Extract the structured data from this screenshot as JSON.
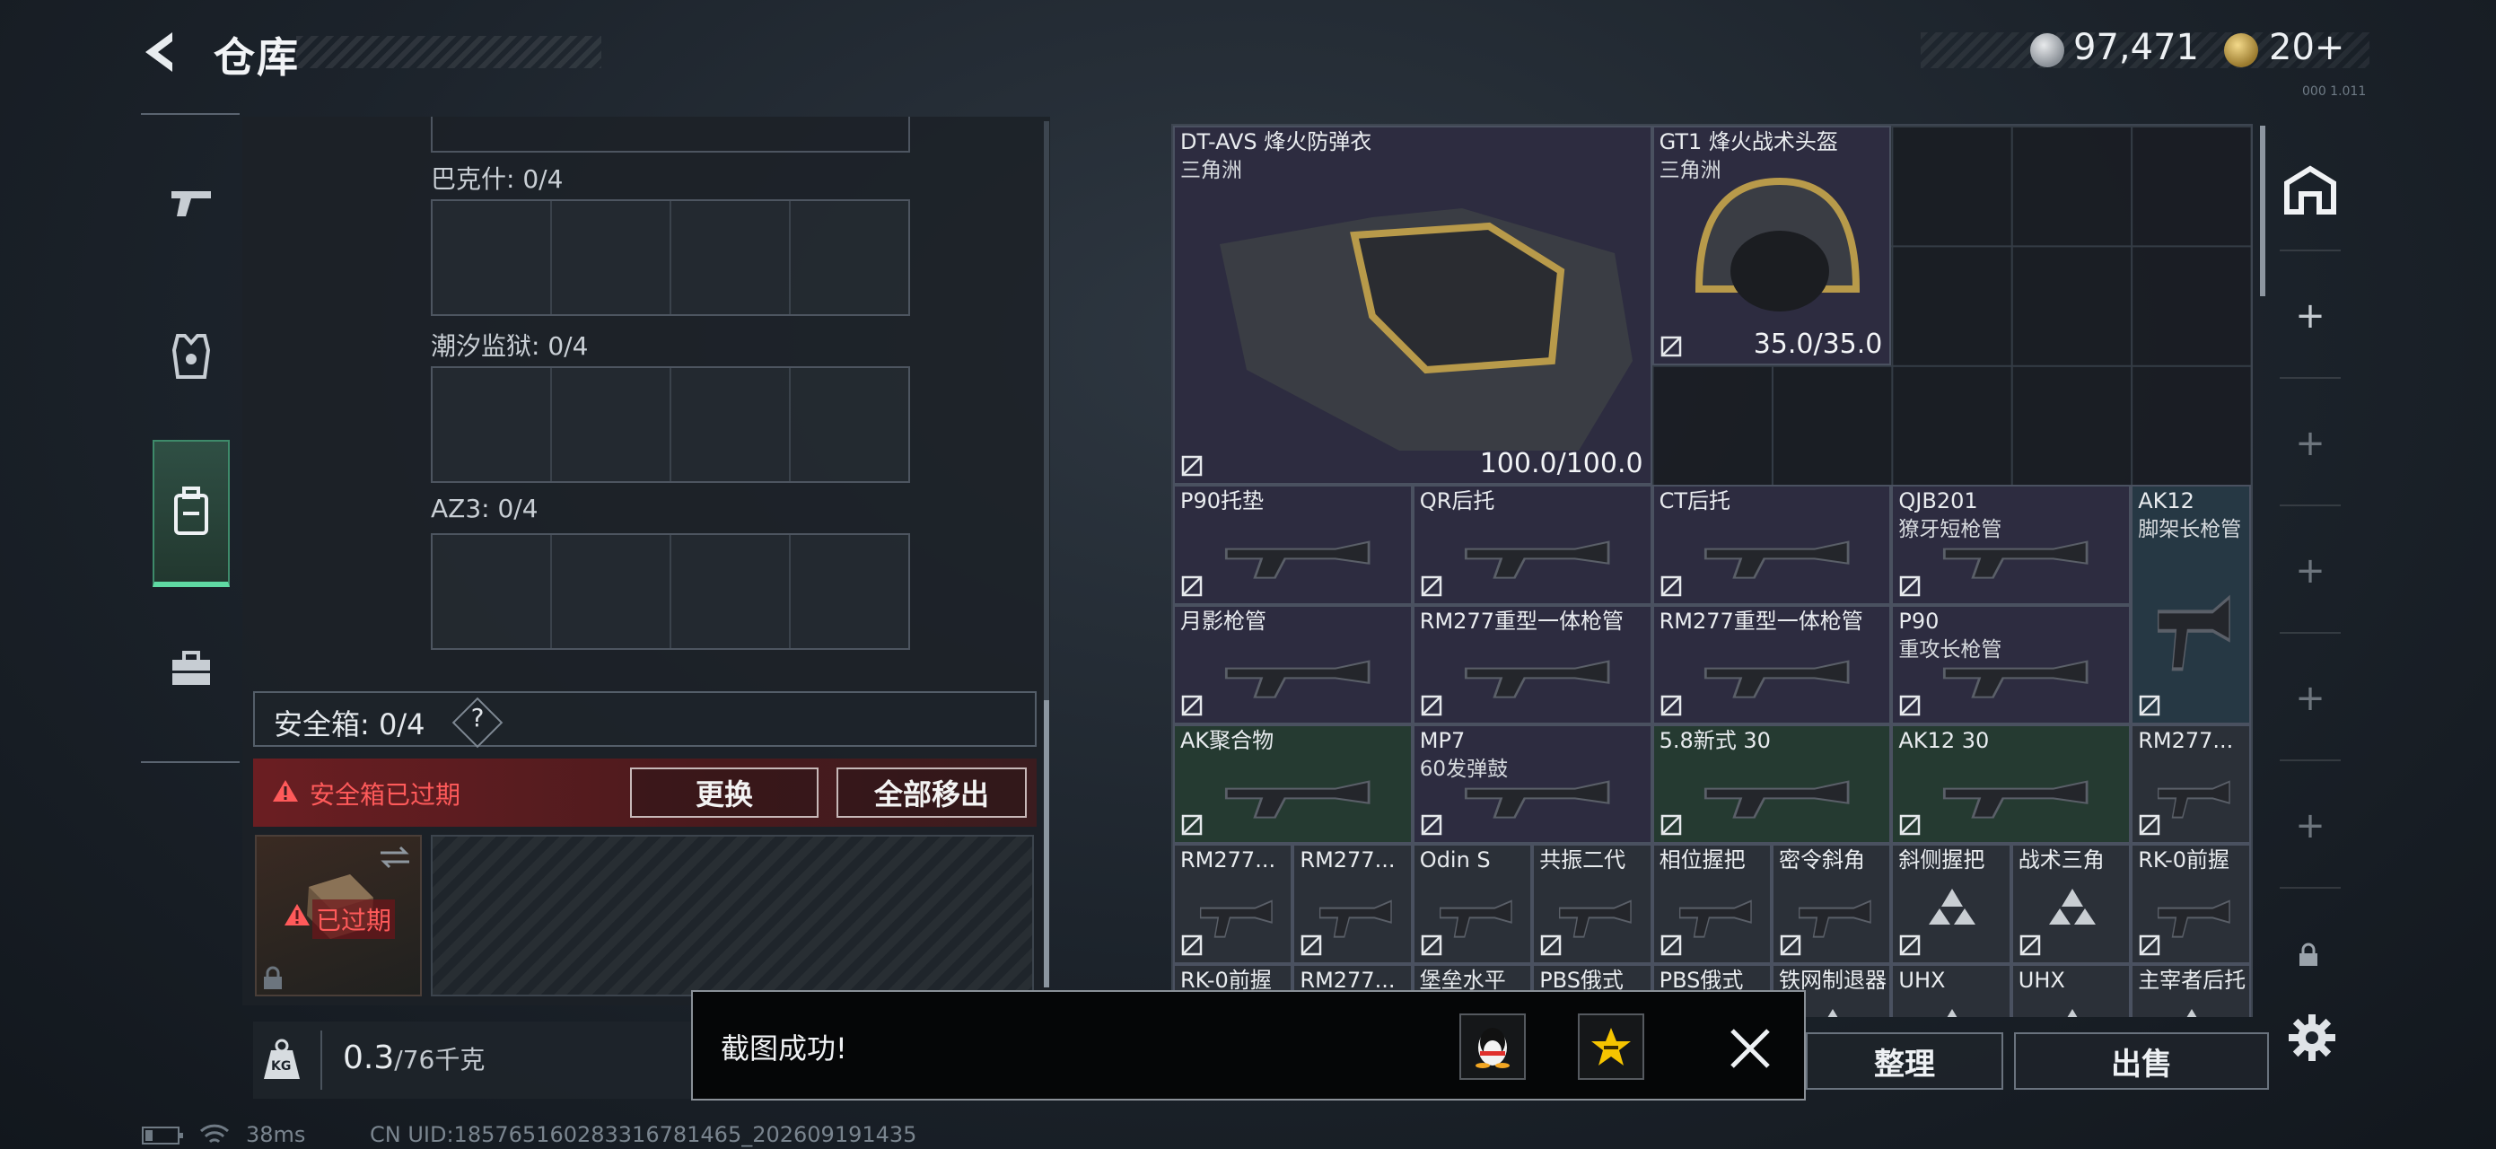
{
  "header": {
    "title": "仓库",
    "coins": "97,471",
    "tickets": "20+",
    "version_tag": "000 1.011"
  },
  "sidenav": {
    "items": [
      {
        "icon": "pistol-icon"
      },
      {
        "icon": "armor-vest-icon"
      },
      {
        "icon": "backpack-icon",
        "active": true
      },
      {
        "icon": "toolbox-icon"
      }
    ]
  },
  "left": {
    "sections": [
      {
        "label": "巴克什: 0/4"
      },
      {
        "label": "潮汐监狱: 0/4"
      },
      {
        "label": "AZ3: 0/4"
      }
    ],
    "safebox_label": "安全箱: 0/4",
    "help_label": "?",
    "expired_text": "安全箱已过期",
    "replace_button": "更换",
    "remove_all_button": "全部移出",
    "item_expired_badge": "已过期",
    "weight": "0.3",
    "weight_max": "/76千克",
    "kg_icon_label": "KG"
  },
  "items": [
    {
      "name": "DT-AVS 烽火防弹衣",
      "sub": "三角洲",
      "value": "100.0/100.0",
      "rarity": "purple",
      "icon": "armor-vest-icon"
    },
    {
      "name": "GT1 烽火战术头盔",
      "sub": "三角洲",
      "value": "35.0/35.0",
      "rarity": "purple",
      "icon": "helmet-icon"
    },
    {
      "name": "P90托垫",
      "rarity": "purple"
    },
    {
      "name": "QR后托",
      "rarity": "purple"
    },
    {
      "name": "CT后托",
      "rarity": "purple"
    },
    {
      "name": "QJB201",
      "sub": "獠牙短枪管",
      "rarity": "purple"
    },
    {
      "name": "AK12",
      "sub": "脚架长枪管",
      "rarity": "teal"
    },
    {
      "name": "月影枪管",
      "rarity": "purple"
    },
    {
      "name": "RM277重型一体枪管",
      "rarity": "purple"
    },
    {
      "name": "RM277重型一体枪管",
      "rarity": "purple"
    },
    {
      "name": "P90",
      "sub": "重攻长枪管",
      "rarity": "purple"
    },
    {
      "name": "AK聚合物",
      "rarity": "green"
    },
    {
      "name": "MP7",
      "sub": "60发弹鼓",
      "rarity": "purple"
    },
    {
      "name": "5.8新式 30",
      "rarity": "green"
    },
    {
      "name": "AK12 30",
      "rarity": "green"
    },
    {
      "name": "RM277...",
      "rarity": "gray"
    },
    {
      "name": "RM277...",
      "rarity": "gray"
    },
    {
      "name": "RM277...",
      "rarity": "gray"
    },
    {
      "name": "Odin S",
      "rarity": "gray"
    },
    {
      "name": "共振二代",
      "rarity": "gray"
    },
    {
      "name": "相位握把",
      "rarity": "gray"
    },
    {
      "name": "密令斜角",
      "rarity": "gray"
    },
    {
      "name": "斜侧握把",
      "rarity": "gray"
    },
    {
      "name": "战术三角",
      "rarity": "gray"
    },
    {
      "name": "RK-0前握",
      "rarity": "gray"
    },
    {
      "name": "RK-0前握"
    },
    {
      "name": "RM277..."
    },
    {
      "name": "堡垒水平"
    },
    {
      "name": "PBS俄式"
    },
    {
      "name": "PBS俄式"
    },
    {
      "name": "铁网制退器"
    },
    {
      "name": "UHX"
    },
    {
      "name": "UHX"
    },
    {
      "name": "主宰者后托"
    }
  ],
  "actions": {
    "sort": "整理",
    "sell": "出售"
  },
  "toast": {
    "text": "截图成功!",
    "share_qq_icon": "qq-penguin-icon",
    "share_qzone_icon": "qzone-star-icon",
    "close_icon": "close-icon"
  },
  "status": {
    "ping": "38ms",
    "uid": "CN UID:18576516028331678146​5_202609191435"
  },
  "colors": {
    "purple": "#2d2c40",
    "green": "#253a31",
    "teal": "#263844",
    "accent_green": "#5fd9a3",
    "warning_red": "#ff5a5a"
  }
}
